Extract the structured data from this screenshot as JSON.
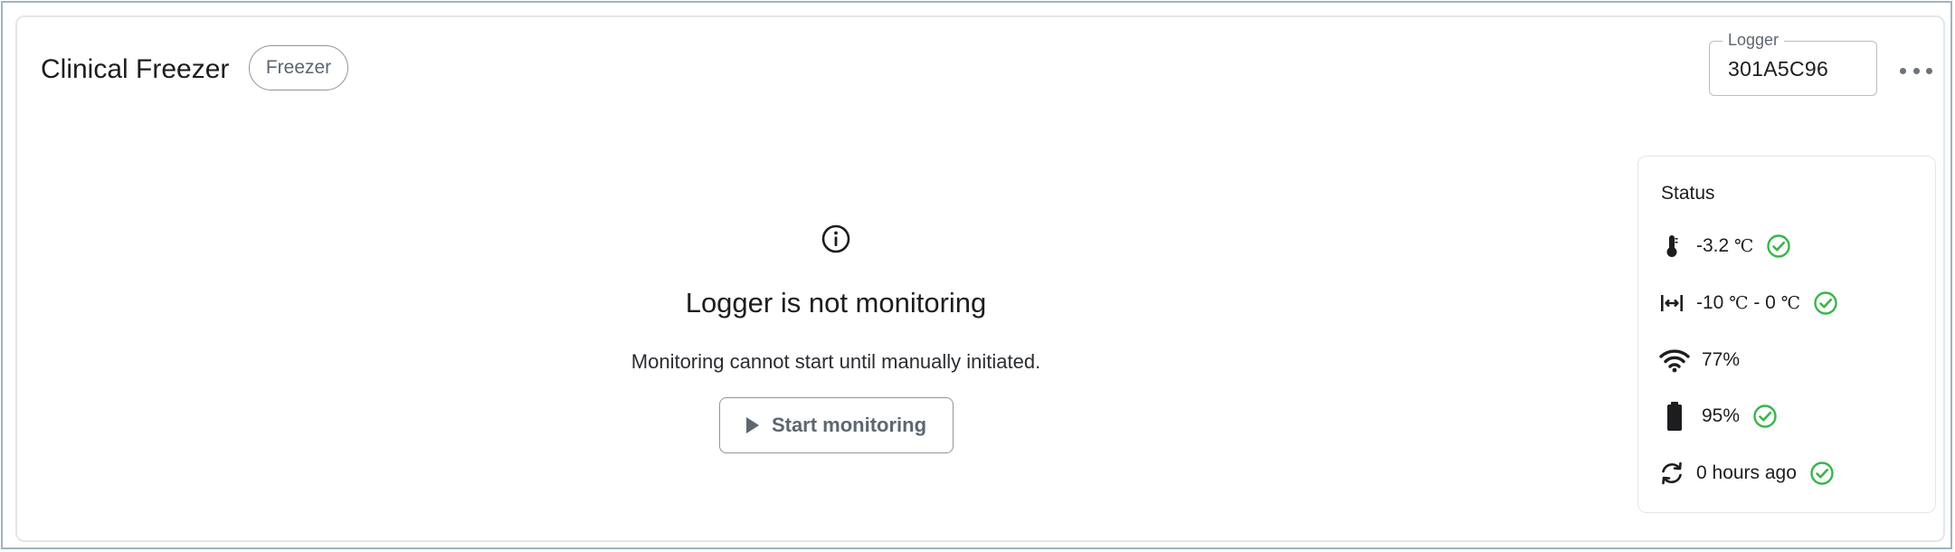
{
  "card": {
    "title": "Clinical Freezer",
    "type_badge": "Freezer",
    "logger": {
      "label": "Logger",
      "value": "301A5C96"
    },
    "more_icon": "more-horizontal-icon"
  },
  "empty_state": {
    "icon": "info-icon",
    "title": "Logger is not monitoring",
    "description": "Monitoring cannot start until manually initiated.",
    "button_label": "Start monitoring",
    "button_icon": "play-icon"
  },
  "status": {
    "title": "Status",
    "temperature": {
      "icon": "thermometer-icon",
      "value": "-3.2",
      "unit": "℃",
      "ok": true
    },
    "range": {
      "icon": "range-icon",
      "min": "-10",
      "max": "0",
      "unit": "℃",
      "ok": true
    },
    "signal": {
      "icon": "wifi-icon",
      "value": "77%"
    },
    "battery": {
      "icon": "battery-icon",
      "value": "95%",
      "ok": true
    },
    "sync": {
      "icon": "sync-icon",
      "value": "0 hours ago",
      "ok": true
    }
  },
  "colors": {
    "ok_green": "#3bb54a",
    "frame_border": "#9fb3c3",
    "muted": "#5d6670"
  }
}
